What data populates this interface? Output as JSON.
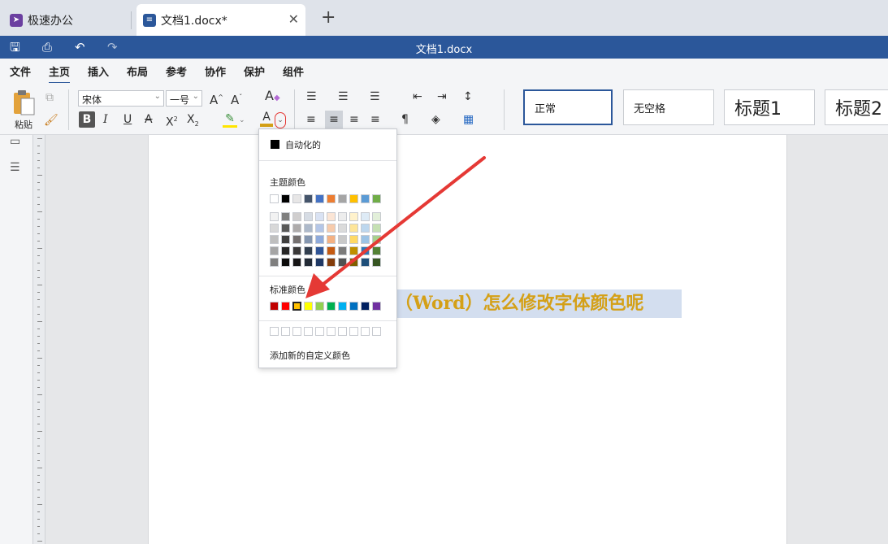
{
  "tabs": [
    {
      "label": "极速办公",
      "active": false,
      "icon": "rocket-icon",
      "icon_color": "#6b3fa0"
    },
    {
      "label": "文档1.docx*",
      "active": true,
      "icon": "document-icon",
      "icon_color": "#2b579a"
    }
  ],
  "new_tab_label": "+",
  "close_label": "✕",
  "title_bar": {
    "title": "文档1.docx",
    "color": "#2b579a"
  },
  "menu": [
    "文件",
    "主页",
    "插入",
    "布局",
    "参考",
    "协作",
    "保护",
    "组件"
  ],
  "active_menu": "主页",
  "ribbon": {
    "paste_label": "粘贴",
    "font_name": "宋体",
    "font_size": "一号",
    "styles": [
      "正常",
      "无空格",
      "标题1",
      "标题2"
    ]
  },
  "document": {
    "visible_text": "（Word）怎么修改字体颜色呢",
    "text_color": "#d4a017",
    "highlight_color": "#d3deef"
  },
  "color_picker": {
    "auto_label": "自动化的",
    "theme_label": "主题颜色",
    "standard_label": "标准颜色",
    "custom_label": "添加新的自定义颜色",
    "theme_top": [
      "#ffffff",
      "#000000",
      "#e7e6e6",
      "#44546a",
      "#4472c4",
      "#ed7d31",
      "#a5a5a5",
      "#ffc000",
      "#5b9bd5",
      "#70ad47"
    ],
    "theme_shades": [
      [
        "#f2f2f2",
        "#7f7f7f",
        "#d0cece",
        "#d6dce4",
        "#d9e2f3",
        "#fbe5d5",
        "#ededed",
        "#fff2cc",
        "#deebf6",
        "#e2efd9"
      ],
      [
        "#d8d8d8",
        "#595959",
        "#aeabab",
        "#adb9ca",
        "#b4c6e7",
        "#f7cbac",
        "#dbdbdb",
        "#fee599",
        "#bdd7ee",
        "#c5e0b3"
      ],
      [
        "#bfbfbf",
        "#3f3f3f",
        "#757070",
        "#8496b0",
        "#8eaadb",
        "#f4b183",
        "#c9c9c9",
        "#ffd965",
        "#9cc3e5",
        "#a8d08d"
      ],
      [
        "#a5a5a5",
        "#262626",
        "#3a3838",
        "#323f4f",
        "#2f5496",
        "#c55a11",
        "#7b7b7b",
        "#bf8f00",
        "#2e75b5",
        "#538135"
      ],
      [
        "#7f7f7f",
        "#0c0c0c",
        "#171616",
        "#222a35",
        "#1f3864",
        "#833c0b",
        "#525252",
        "#7f6000",
        "#1e4e79",
        "#375623"
      ]
    ],
    "standard": [
      "#c00000",
      "#ff0000",
      "#ffc000",
      "#ffff00",
      "#92d050",
      "#00b050",
      "#00b0f0",
      "#0070c0",
      "#002060",
      "#7030a0"
    ],
    "selected_standard_index": 2,
    "custom_slots": 10
  },
  "annotation_arrow_color": "#e53935"
}
